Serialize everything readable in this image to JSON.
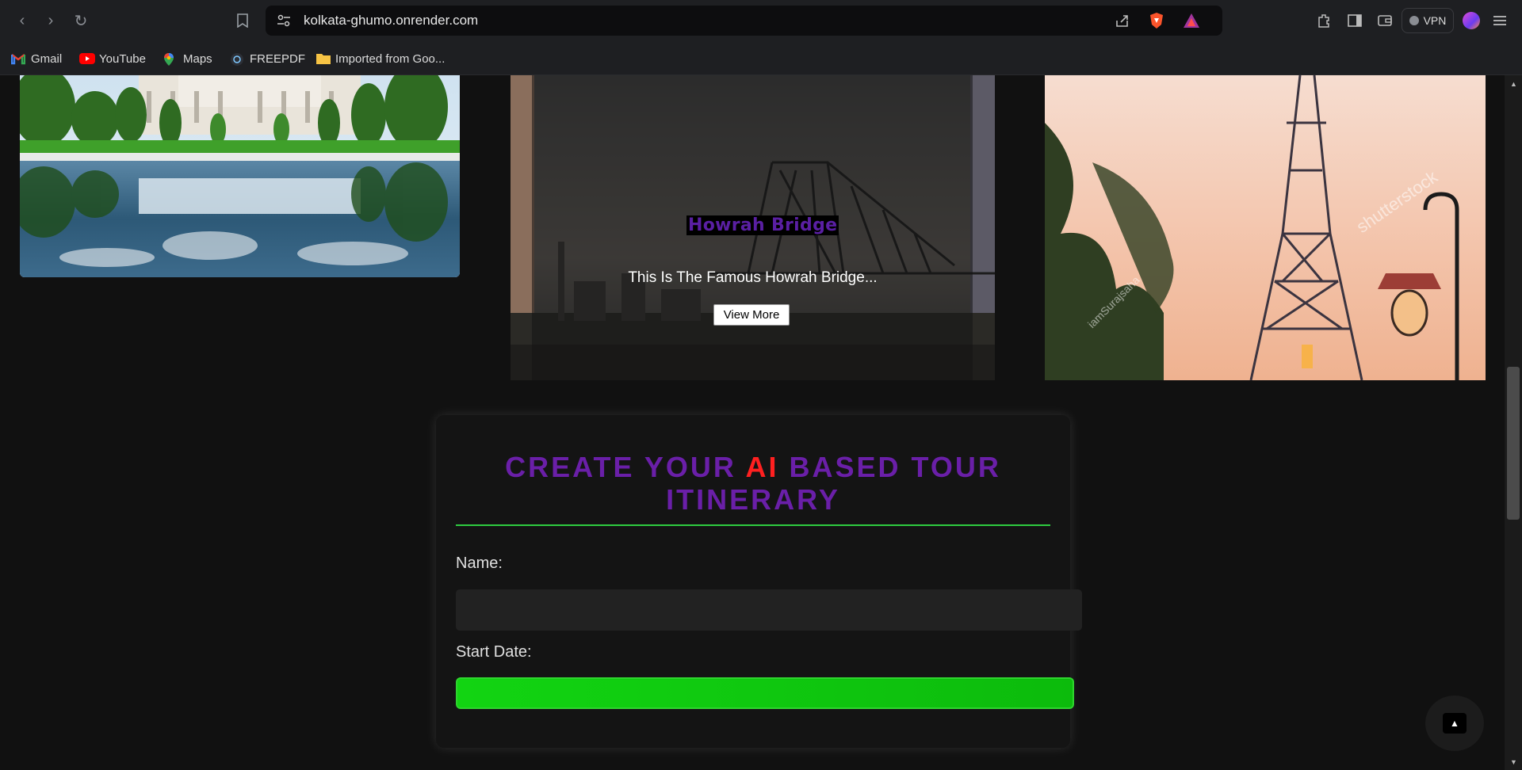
{
  "browser": {
    "url": "kolkata-ghumo.onrender.com",
    "vpn_label": "VPN",
    "bookmarks": [
      {
        "label": "Gmail",
        "icon": "gmail-icon"
      },
      {
        "label": "YouTube",
        "icon": "youtube-icon"
      },
      {
        "label": "Maps",
        "icon": "maps-icon"
      },
      {
        "label": "FREEPDF",
        "icon": "freepdf-icon"
      },
      {
        "label": "Imported from Goo...",
        "icon": "folder-icon"
      }
    ]
  },
  "carousel": {
    "active_card": {
      "title": "Howrah Bridge",
      "description": "This Is The Famous Howrah Bridge...",
      "button_label": "View More"
    },
    "watermark_text": "shutterstock",
    "credit_text": "iamSurajsaha"
  },
  "form": {
    "title_part1": "CREATE YOUR ",
    "title_highlight": "AI",
    "title_part2": " BASED TOUR ITINERARY",
    "name_label": "Name:",
    "name_value": "",
    "start_date_label": "Start Date:"
  },
  "colors": {
    "accent_purple": "#6a1fa8",
    "accent_red": "#ff2020",
    "accent_green": "#2ecc40",
    "page_bg": "#111111"
  }
}
